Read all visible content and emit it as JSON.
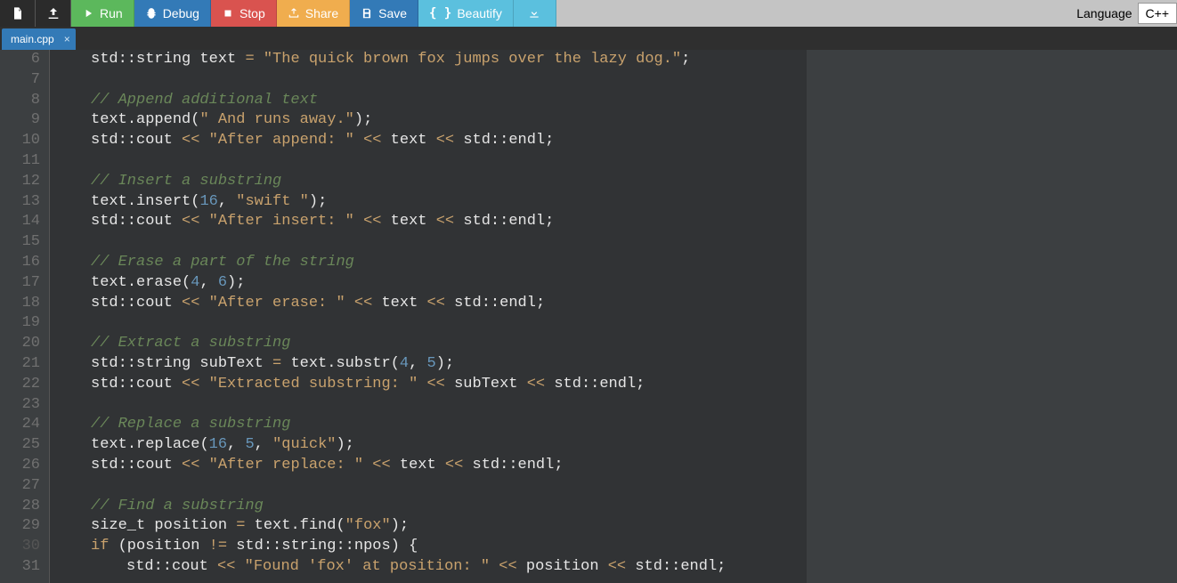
{
  "toolbar": {
    "run": "Run",
    "debug": "Debug",
    "stop": "Stop",
    "share": "Share",
    "save": "Save",
    "beautify": "Beautify"
  },
  "language": {
    "label": "Language",
    "value": "C++"
  },
  "tab": {
    "name": "main.cpp"
  },
  "gutter": {
    "start": 6,
    "end": 31,
    "dim": [
      30
    ]
  },
  "code": {
    "l6": {
      "indent": 1,
      "tokens": [
        [
          "type",
          "std"
        ],
        [
          "punct",
          "::"
        ],
        [
          "type",
          "string text "
        ],
        [
          "op",
          "="
        ],
        [
          "punct",
          " "
        ],
        [
          "string",
          "\"The quick brown fox jumps over the lazy dog.\""
        ],
        [
          "punct",
          ";"
        ]
      ]
    },
    "l7": {
      "indent": 0,
      "tokens": []
    },
    "l8": {
      "indent": 1,
      "tokens": [
        [
          "comment",
          "// Append additional text"
        ]
      ]
    },
    "l9": {
      "indent": 1,
      "tokens": [
        [
          "ident",
          "text"
        ],
        [
          "punct",
          "."
        ],
        [
          "ident",
          "append"
        ],
        [
          "punct",
          "("
        ],
        [
          "string",
          "\" And runs away.\""
        ],
        [
          "punct",
          ");"
        ]
      ]
    },
    "l10": {
      "indent": 1,
      "tokens": [
        [
          "type",
          "std"
        ],
        [
          "punct",
          "::"
        ],
        [
          "ident",
          "cout "
        ],
        [
          "op",
          "<<"
        ],
        [
          "punct",
          " "
        ],
        [
          "string",
          "\"After append: \""
        ],
        [
          "punct",
          " "
        ],
        [
          "op",
          "<<"
        ],
        [
          "punct",
          " text "
        ],
        [
          "op",
          "<<"
        ],
        [
          "punct",
          " "
        ],
        [
          "type",
          "std"
        ],
        [
          "punct",
          "::"
        ],
        [
          "ident",
          "endl"
        ],
        [
          "punct",
          ";"
        ]
      ]
    },
    "l11": {
      "indent": 0,
      "tokens": []
    },
    "l12": {
      "indent": 1,
      "tokens": [
        [
          "comment",
          "// Insert a substring"
        ]
      ]
    },
    "l13": {
      "indent": 1,
      "tokens": [
        [
          "ident",
          "text"
        ],
        [
          "punct",
          "."
        ],
        [
          "ident",
          "insert"
        ],
        [
          "punct",
          "("
        ],
        [
          "number",
          "16"
        ],
        [
          "punct",
          ", "
        ],
        [
          "string",
          "\"swift \""
        ],
        [
          "punct",
          ");"
        ]
      ]
    },
    "l14": {
      "indent": 1,
      "tokens": [
        [
          "type",
          "std"
        ],
        [
          "punct",
          "::"
        ],
        [
          "ident",
          "cout "
        ],
        [
          "op",
          "<<"
        ],
        [
          "punct",
          " "
        ],
        [
          "string",
          "\"After insert: \""
        ],
        [
          "punct",
          " "
        ],
        [
          "op",
          "<<"
        ],
        [
          "punct",
          " text "
        ],
        [
          "op",
          "<<"
        ],
        [
          "punct",
          " "
        ],
        [
          "type",
          "std"
        ],
        [
          "punct",
          "::"
        ],
        [
          "ident",
          "endl"
        ],
        [
          "punct",
          ";"
        ]
      ]
    },
    "l15": {
      "indent": 0,
      "tokens": []
    },
    "l16": {
      "indent": 1,
      "tokens": [
        [
          "comment",
          "// Erase a part of the string"
        ]
      ]
    },
    "l17": {
      "indent": 1,
      "tokens": [
        [
          "ident",
          "text"
        ],
        [
          "punct",
          "."
        ],
        [
          "ident",
          "erase"
        ],
        [
          "punct",
          "("
        ],
        [
          "number",
          "4"
        ],
        [
          "punct",
          ", "
        ],
        [
          "number",
          "6"
        ],
        [
          "punct",
          ");"
        ]
      ]
    },
    "l18": {
      "indent": 1,
      "tokens": [
        [
          "type",
          "std"
        ],
        [
          "punct",
          "::"
        ],
        [
          "ident",
          "cout "
        ],
        [
          "op",
          "<<"
        ],
        [
          "punct",
          " "
        ],
        [
          "string",
          "\"After erase: \""
        ],
        [
          "punct",
          " "
        ],
        [
          "op",
          "<<"
        ],
        [
          "punct",
          " text "
        ],
        [
          "op",
          "<<"
        ],
        [
          "punct",
          " "
        ],
        [
          "type",
          "std"
        ],
        [
          "punct",
          "::"
        ],
        [
          "ident",
          "endl"
        ],
        [
          "punct",
          ";"
        ]
      ]
    },
    "l19": {
      "indent": 0,
      "tokens": []
    },
    "l20": {
      "indent": 1,
      "tokens": [
        [
          "comment",
          "// Extract a substring"
        ]
      ]
    },
    "l21": {
      "indent": 1,
      "tokens": [
        [
          "type",
          "std"
        ],
        [
          "punct",
          "::"
        ],
        [
          "type",
          "string subText "
        ],
        [
          "op",
          "="
        ],
        [
          "punct",
          " text"
        ],
        [
          "punct",
          "."
        ],
        [
          "ident",
          "substr"
        ],
        [
          "punct",
          "("
        ],
        [
          "number",
          "4"
        ],
        [
          "punct",
          ", "
        ],
        [
          "number",
          "5"
        ],
        [
          "punct",
          ");"
        ]
      ]
    },
    "l22": {
      "indent": 1,
      "tokens": [
        [
          "type",
          "std"
        ],
        [
          "punct",
          "::"
        ],
        [
          "ident",
          "cout "
        ],
        [
          "op",
          "<<"
        ],
        [
          "punct",
          " "
        ],
        [
          "string",
          "\"Extracted substring: \""
        ],
        [
          "punct",
          " "
        ],
        [
          "op",
          "<<"
        ],
        [
          "punct",
          " subText "
        ],
        [
          "op",
          "<<"
        ],
        [
          "punct",
          " "
        ],
        [
          "type",
          "std"
        ],
        [
          "punct",
          "::"
        ],
        [
          "ident",
          "endl"
        ],
        [
          "punct",
          ";"
        ]
      ]
    },
    "l23": {
      "indent": 0,
      "tokens": []
    },
    "l24": {
      "indent": 1,
      "tokens": [
        [
          "comment",
          "// Replace a substring"
        ]
      ]
    },
    "l25": {
      "indent": 1,
      "tokens": [
        [
          "ident",
          "text"
        ],
        [
          "punct",
          "."
        ],
        [
          "ident",
          "replace"
        ],
        [
          "punct",
          "("
        ],
        [
          "number",
          "16"
        ],
        [
          "punct",
          ", "
        ],
        [
          "number",
          "5"
        ],
        [
          "punct",
          ", "
        ],
        [
          "string",
          "\"quick\""
        ],
        [
          "punct",
          ");"
        ]
      ]
    },
    "l26": {
      "indent": 1,
      "tokens": [
        [
          "type",
          "std"
        ],
        [
          "punct",
          "::"
        ],
        [
          "ident",
          "cout "
        ],
        [
          "op",
          "<<"
        ],
        [
          "punct",
          " "
        ],
        [
          "string",
          "\"After replace: \""
        ],
        [
          "punct",
          " "
        ],
        [
          "op",
          "<<"
        ],
        [
          "punct",
          " text "
        ],
        [
          "op",
          "<<"
        ],
        [
          "punct",
          " "
        ],
        [
          "type",
          "std"
        ],
        [
          "punct",
          "::"
        ],
        [
          "ident",
          "endl"
        ],
        [
          "punct",
          ";"
        ]
      ]
    },
    "l27": {
      "indent": 0,
      "tokens": []
    },
    "l28": {
      "indent": 1,
      "tokens": [
        [
          "comment",
          "// Find a substring"
        ]
      ]
    },
    "l29": {
      "indent": 1,
      "tokens": [
        [
          "type",
          "size_t position "
        ],
        [
          "op",
          "="
        ],
        [
          "punct",
          " text"
        ],
        [
          "punct",
          "."
        ],
        [
          "ident",
          "find"
        ],
        [
          "punct",
          "("
        ],
        [
          "string",
          "\"fox\""
        ],
        [
          "punct",
          ");"
        ]
      ]
    },
    "l30": {
      "indent": 1,
      "tokens": [
        [
          "keyword",
          "if"
        ],
        [
          "punct",
          " (position "
        ],
        [
          "op",
          "!="
        ],
        [
          "punct",
          " "
        ],
        [
          "type",
          "std"
        ],
        [
          "punct",
          "::"
        ],
        [
          "type",
          "string"
        ],
        [
          "punct",
          "::"
        ],
        [
          "ident",
          "npos"
        ],
        [
          "punct",
          ") {"
        ]
      ]
    },
    "l31": {
      "indent": 2,
      "tokens": [
        [
          "type",
          "std"
        ],
        [
          "punct",
          "::"
        ],
        [
          "ident",
          "cout "
        ],
        [
          "op",
          "<<"
        ],
        [
          "punct",
          " "
        ],
        [
          "string",
          "\"Found 'fox' at position: \""
        ],
        [
          "punct",
          " "
        ],
        [
          "op",
          "<<"
        ],
        [
          "punct",
          " position "
        ],
        [
          "op",
          "<<"
        ],
        [
          "punct",
          " "
        ],
        [
          "type",
          "std"
        ],
        [
          "punct",
          "::"
        ],
        [
          "ident",
          "endl"
        ],
        [
          "punct",
          ";"
        ]
      ]
    }
  }
}
